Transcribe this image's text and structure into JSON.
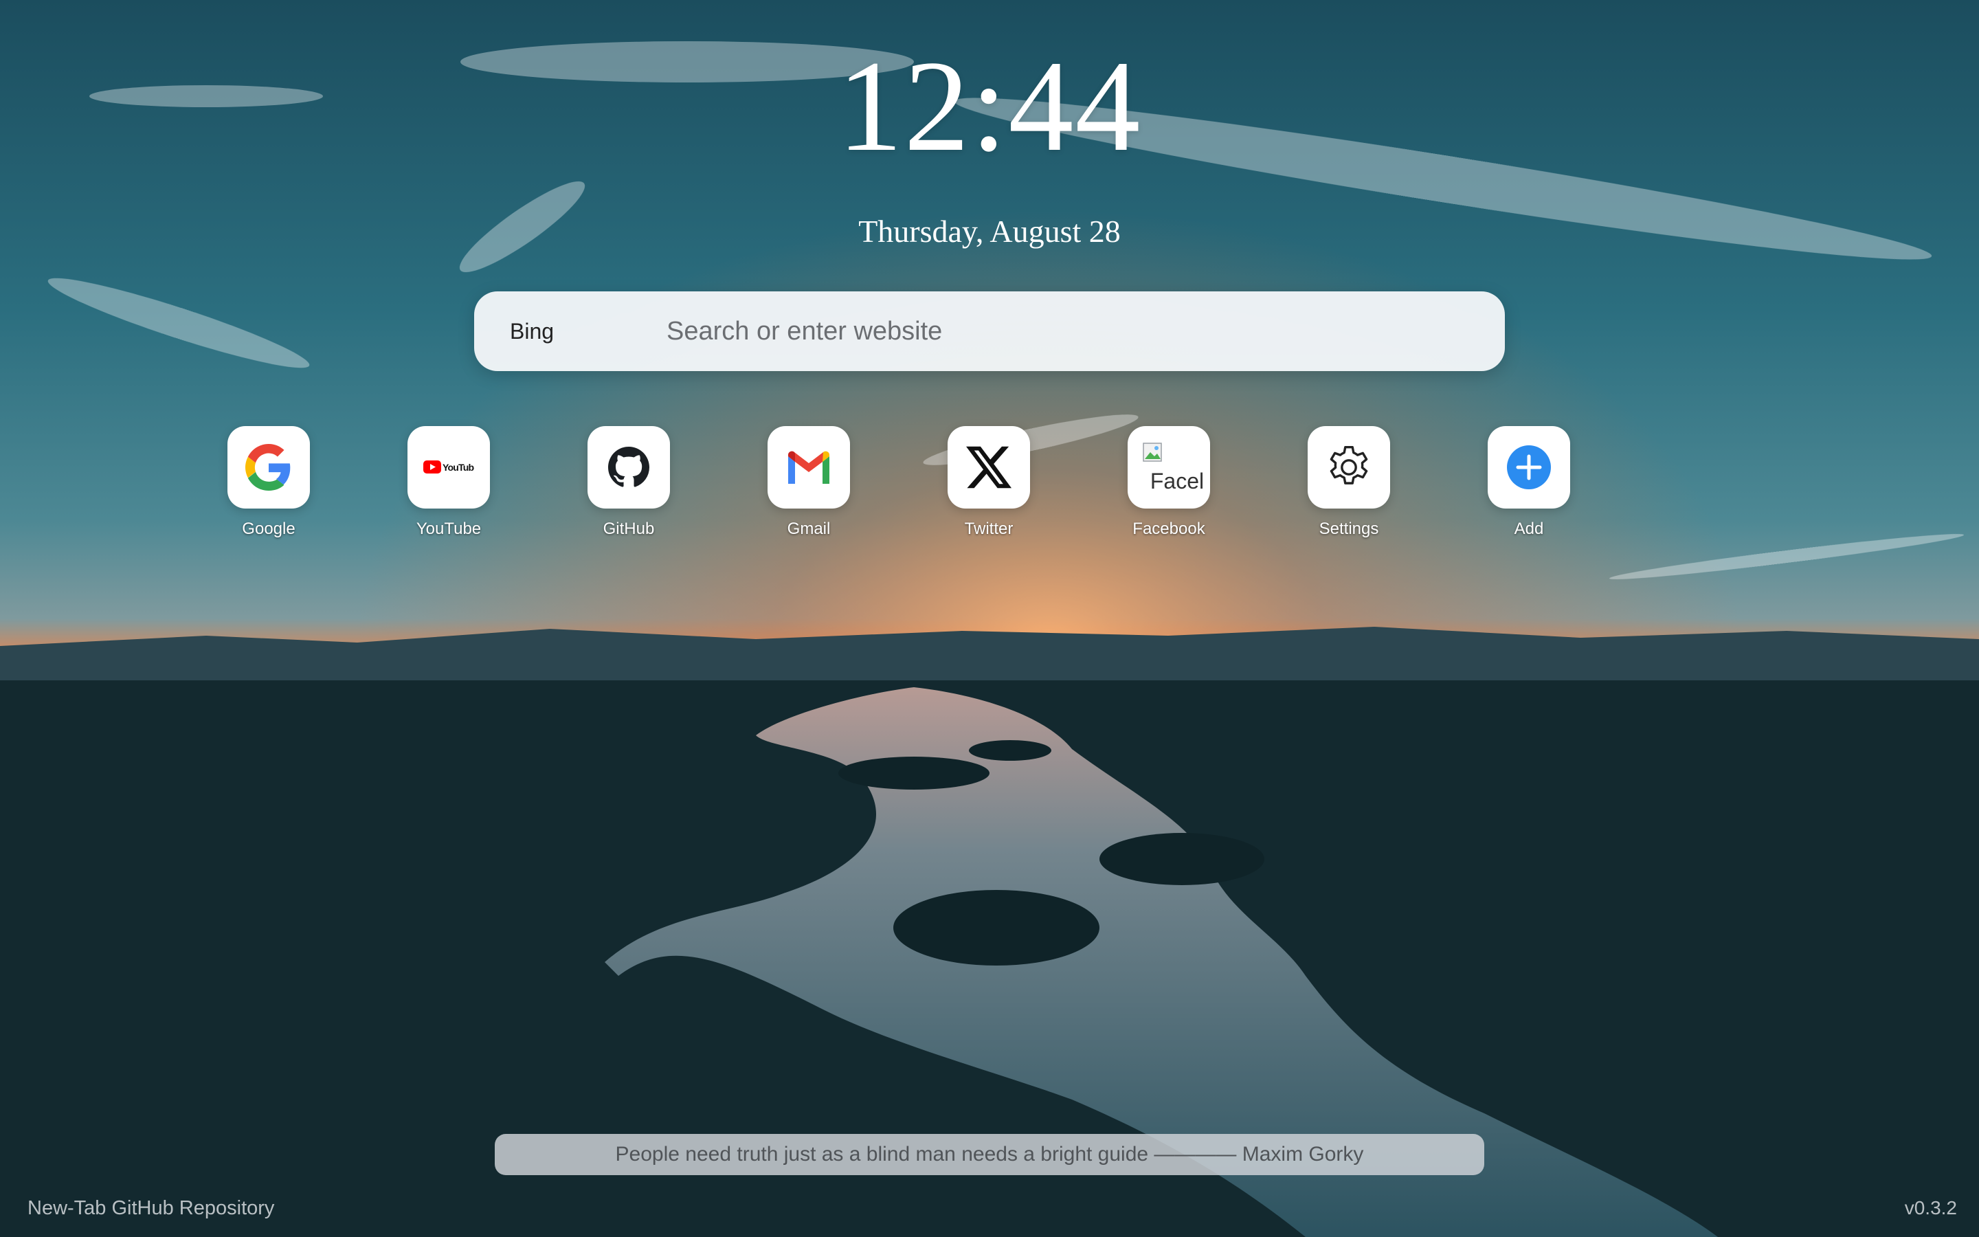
{
  "clock": {
    "time": "12:44"
  },
  "date": {
    "text": "Thursday, August 28"
  },
  "search": {
    "engine": "Bing",
    "placeholder": "Search or enter website"
  },
  "shortcuts": [
    {
      "label": "Google",
      "icon": "google-icon"
    },
    {
      "label": "YouTube",
      "icon": "youtube-icon",
      "logo_text": "YouTube"
    },
    {
      "label": "GitHub",
      "icon": "github-icon"
    },
    {
      "label": "Gmail",
      "icon": "gmail-icon"
    },
    {
      "label": "Twitter",
      "icon": "x-icon"
    },
    {
      "label": "Facebook",
      "icon": "broken-image-icon",
      "alt_text": "Facel"
    },
    {
      "label": "Settings",
      "icon": "gear-icon"
    },
    {
      "label": "Add",
      "icon": "plus-icon"
    }
  ],
  "quote": {
    "text": "People need truth just as a blind man needs a bright guide ———— Maxim Gorky"
  },
  "footer": {
    "repo_link": "New-Tab GitHub Repository",
    "version": "v0.3.2"
  },
  "colors": {
    "add_blue": "#2b8cf0",
    "google_blue": "#4285F4",
    "google_red": "#EA4335",
    "google_yellow": "#FBBC05",
    "google_green": "#34A853"
  }
}
